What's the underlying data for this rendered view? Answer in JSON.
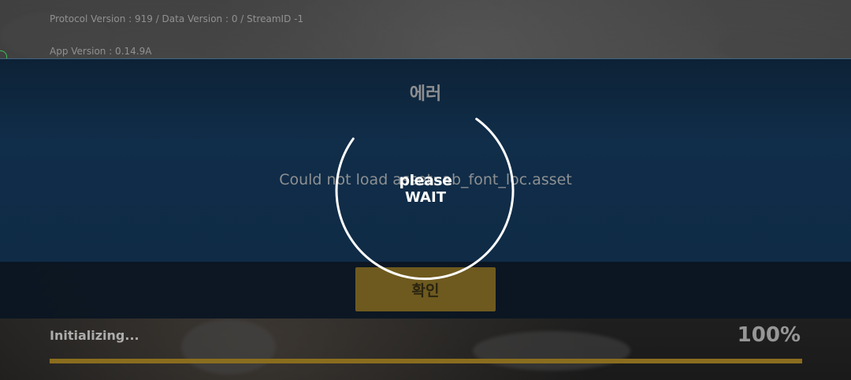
{
  "header": {
    "protocol_line": "Protocol Version : 919 / Data Version : 0 / StreamID -1",
    "app_version_line": "App Version : 0.14.9A"
  },
  "dialog": {
    "title": "에러",
    "message": "Could not load asset: ab_font_loc.asset",
    "confirm_label": "확인"
  },
  "overlay": {
    "line1": "please",
    "line2": "WAIT"
  },
  "loading": {
    "status": "Initializing...",
    "percent_text": "100%",
    "progress": 1.0
  },
  "colors": {
    "dialog_bg": "#0f2b46",
    "button_bg": "#6e5a1f",
    "progress_fill": "#8a6d1e",
    "side_tab_border": "#3fbf5a"
  }
}
